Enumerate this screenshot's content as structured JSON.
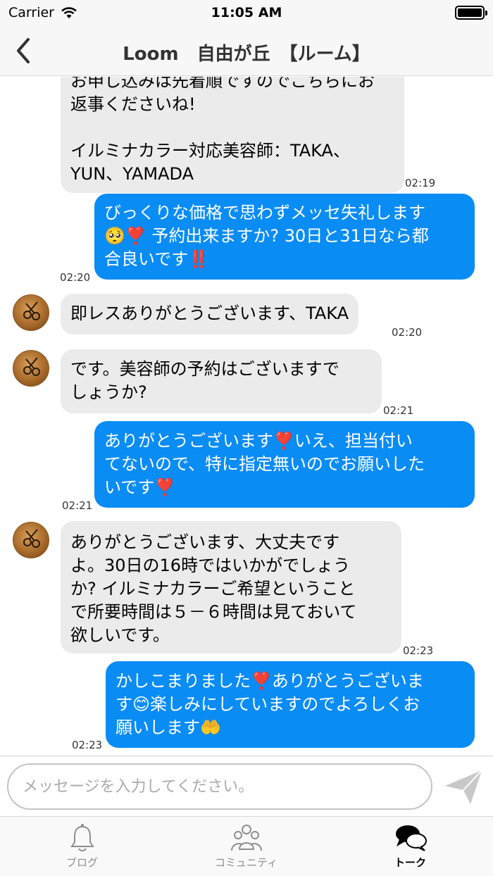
{
  "status_bar": {
    "carrier": "Carrier",
    "time": "11:05 AM"
  },
  "nav": {
    "back_icon": "chevron-left-icon",
    "title": "Loom　自由が丘　【ルーム】"
  },
  "messages": [
    {
      "side": "in",
      "text": "お申し込みは先着順ですのでこちらにお\n返事くださいね!\n\nイルミナカラー対応美容師：TAKA、\nYUN、YAMADA",
      "time": "02:19",
      "avatar": false
    },
    {
      "side": "out",
      "text": "びっくりな価格で思わずメッセ失礼します\n🥺❣️ 予約出来ますか? 30日と31日なら都\n合良いです‼️",
      "time": "02:20"
    },
    {
      "side": "in",
      "text": "即レスありがとうございます、TAKA",
      "time": "02:20",
      "avatar": true
    },
    {
      "side": "in",
      "text": "です。美容師の予約はございますで\nしょうか?",
      "time": "02:21",
      "avatar": true
    },
    {
      "side": "out",
      "text": "ありがとうございます❣️いえ、担当付い\nてないので、特に指定無いのでお願いした\nいです❣️",
      "time": "02:21"
    },
    {
      "side": "in",
      "text": "ありがとうございます、大丈夫です\nよ。30日の16時ではいかがでしょう\nか? イルミナカラーご希望ということ\nで所要時間は５－６時間は見ておいて\n欲しいです。",
      "time": "02:23",
      "avatar": true
    },
    {
      "side": "out",
      "text": "かしこまりました❣️ありがとうございま\nす😊楽しみにしていますのでよろしくお\n願いします🤲",
      "time": "02:23"
    }
  ],
  "input": {
    "placeholder": "メッセージを入力してください。",
    "value": "",
    "send_icon": "paper-plane-icon"
  },
  "tabs": [
    {
      "label": "ブログ",
      "icon": "bell-icon",
      "active": false
    },
    {
      "label": "コミュニティ",
      "icon": "people-icon",
      "active": false
    },
    {
      "label": "トーク",
      "icon": "chat-bubbles-icon",
      "active": true
    }
  ],
  "colors": {
    "outgoing_bubble": "#0a8cf5",
    "incoming_bubble": "#ebebeb",
    "bar_background": "#f7f7f7"
  }
}
